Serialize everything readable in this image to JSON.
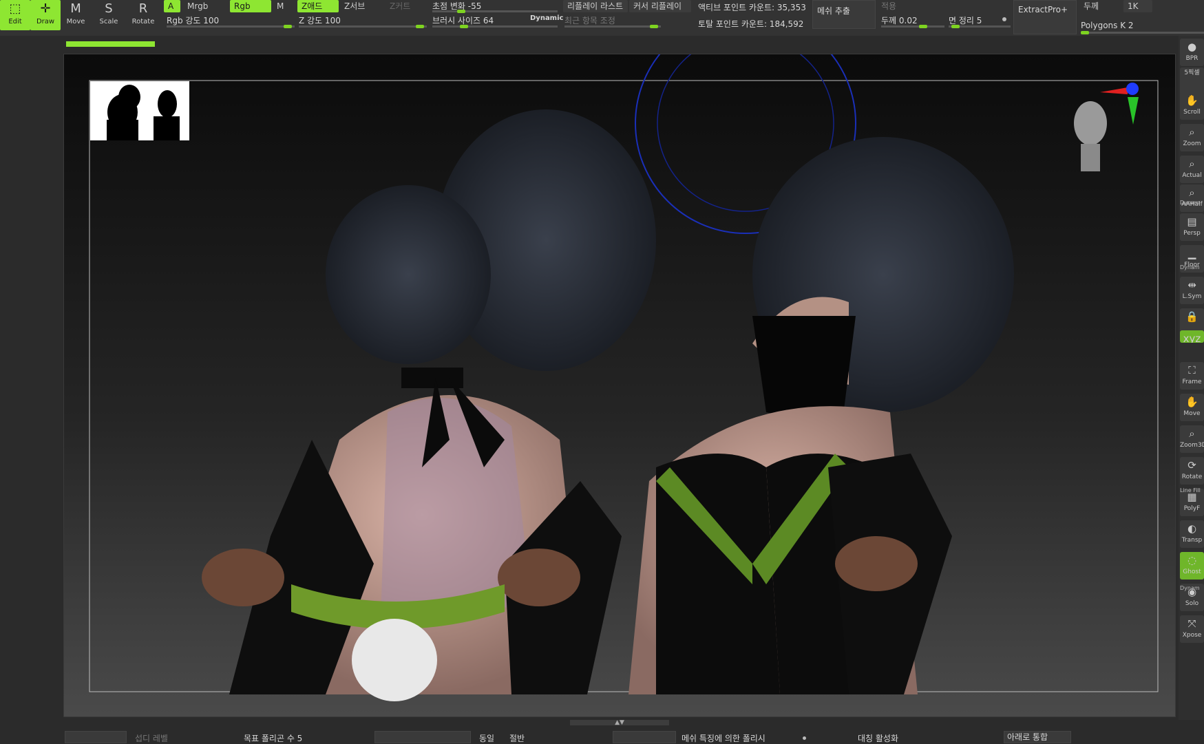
{
  "tools": [
    {
      "label": "Edit",
      "active": true
    },
    {
      "label": "Draw",
      "active": true
    },
    {
      "label": "Move",
      "active": false
    },
    {
      "label": "Scale",
      "active": false
    },
    {
      "label": "Rotate",
      "active": false
    }
  ],
  "material": {
    "a": "A",
    "mrgb": "Mrgb",
    "rgb": "Rgb",
    "m": "M",
    "rgb_intensity": "Rgb 강도 100",
    "zadd": "Z애드",
    "zsub": "Z서브",
    "zcut": "Z커트",
    "z_intensity": "Z 강도 100"
  },
  "brush": {
    "focal_shift": "초점 변화 -55",
    "draw_size": "브러시 사이즈 64",
    "dynamic": "Dynamic",
    "recent_adjust": "최근 항목 조정"
  },
  "replay": {
    "last": "리플레이 라스트",
    "cursor": "커서 리플레이"
  },
  "counts": {
    "active_points": "액티브 포인트 카운트: 35,353",
    "total_points": "토탈 포인트 카운트: 184,592"
  },
  "mesh_extract": "메쉬 추출",
  "extract_panel": {
    "apply": "적용",
    "thickness": "두께 0.02",
    "smooth": "면 정리 5",
    "extract_pro": "ExtractPro+"
  },
  "right_panel": {
    "thickness": "두께",
    "res": "1K",
    "polygons": "Polygons K 2"
  },
  "shelf": [
    {
      "icon": "bpr-sphere-icon",
      "label": "BPR"
    },
    {
      "icon": "",
      "label": "5픽셀"
    },
    {
      "icon": "hand-icon",
      "label": "Scroll"
    },
    {
      "icon": "zoom-icon",
      "label": "Zoom"
    },
    {
      "icon": "zoom-icon",
      "label": "Actual"
    },
    {
      "icon": "zoom-icon",
      "label": "AAHalf"
    },
    {
      "icon": "persp-icon",
      "label": "Persp"
    },
    {
      "icon": "floor-icon",
      "label": "Floor"
    },
    {
      "icon": "lsym-icon",
      "label": "L.Sym"
    },
    {
      "icon": "lock-icon",
      "label": ""
    },
    {
      "icon": "xyz-icon",
      "label": "Xyz"
    },
    {
      "icon": "frame-icon",
      "label": "Frame"
    },
    {
      "icon": "hand-icon",
      "label": "Move"
    },
    {
      "icon": "zoom-icon",
      "label": "Zoom3D"
    },
    {
      "icon": "rotate-icon",
      "label": "Rotate"
    },
    {
      "icon": "grid-icon",
      "label": "PolyF"
    },
    {
      "icon": "transp-icon",
      "label": "Transp"
    },
    {
      "icon": "ghost-icon",
      "label": "Ghost"
    },
    {
      "icon": "solo-icon",
      "label": "Solo"
    },
    {
      "icon": "xpose-icon",
      "label": "Xpose"
    }
  ],
  "shelf_headers": [
    "Dynam",
    "Dynam",
    "Line Fill",
    "Dynam"
  ],
  "bottom": {
    "subdiv": "섭디 레벨",
    "target_poly": "목표 폴리곤 수 5",
    "same": "동일",
    "half": "절반",
    "polish": "메쉬 특징에 의한 폴리시",
    "symmetry": "대칭 활성화",
    "merge_down": "아래로 통합"
  },
  "colors": {
    "accent": "#8ee632",
    "toolbar_bg": "#333333",
    "canvas_bg": "#1a1a1a"
  },
  "progress_fraction": 0.08
}
